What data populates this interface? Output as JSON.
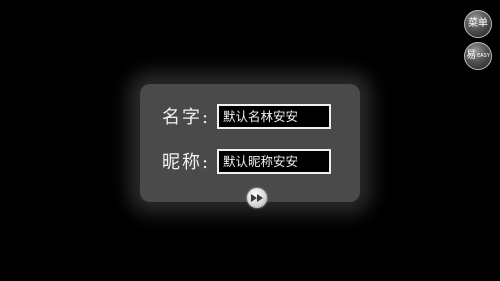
{
  "form": {
    "name_label": "名字:",
    "name_value": "默认名林安安",
    "nickname_label": "昵称:",
    "nickname_value": "默认昵称安安"
  },
  "buttons": {
    "next_icon": "fast-forward-icon",
    "menu_label": "菜单",
    "easy_label_main": "易",
    "easy_label_small": "EASY"
  }
}
